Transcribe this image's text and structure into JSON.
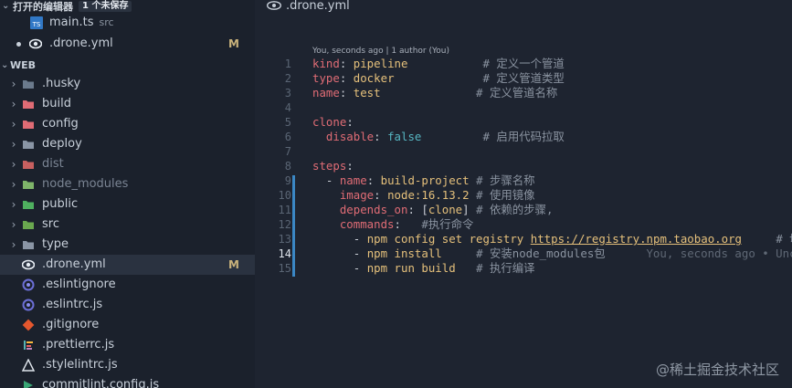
{
  "sidebar": {
    "open_editors": {
      "title": "打开的编辑器",
      "badge": "1 个未保存"
    },
    "open_files": [
      {
        "label": "main.ts",
        "desc": "src",
        "icon": "typescript-icon"
      },
      {
        "label": ".drone.yml",
        "modified": "M",
        "icon": "drone-icon"
      }
    ],
    "section_title": "WEB",
    "tree": [
      {
        "label": ".husky",
        "type": "folder",
        "icon": "husky-folder-icon"
      },
      {
        "label": "build",
        "type": "folder",
        "icon": "build-folder-icon"
      },
      {
        "label": "config",
        "type": "folder",
        "icon": "config-folder-icon"
      },
      {
        "label": "deploy",
        "type": "folder",
        "icon": "folder-icon"
      },
      {
        "label": "dist",
        "type": "folder",
        "icon": "dist-folder-icon"
      },
      {
        "label": "node_modules",
        "type": "folder",
        "icon": "node-modules-folder-icon"
      },
      {
        "label": "public",
        "type": "folder",
        "icon": "public-folder-icon"
      },
      {
        "label": "src",
        "type": "folder",
        "icon": "src-folder-icon"
      },
      {
        "label": "type",
        "type": "folder",
        "icon": "folder-icon"
      },
      {
        "label": ".drone.yml",
        "type": "file",
        "modified": "M",
        "icon": "drone-icon"
      },
      {
        "label": ".eslintignore",
        "type": "file",
        "icon": "eslint-icon"
      },
      {
        "label": ".eslintrc.js",
        "type": "file",
        "icon": "eslint-icon"
      },
      {
        "label": ".gitignore",
        "type": "file",
        "icon": "git-icon"
      },
      {
        "label": ".prettierrc.js",
        "type": "file",
        "icon": "prettier-icon"
      },
      {
        "label": ".stylelintrc.js",
        "type": "file",
        "icon": "stylelint-icon"
      },
      {
        "label": "commitlint.config.js",
        "type": "file",
        "icon": "commitlint-icon"
      }
    ]
  },
  "editor": {
    "tab_label": ".drone.yml",
    "blame_header": "You, seconds ago | 1 author (You)",
    "current_line_blame": "You, seconds ago • Unc",
    "line_numbers": [
      "1",
      "2",
      "3",
      "4",
      "5",
      "6",
      "7",
      "8",
      "9",
      "10",
      "11",
      "12",
      "13",
      "14",
      "15"
    ],
    "code": {
      "l1_key": "kind",
      "l1_val": "pipeline",
      "l1_comment": "# 定义一个管道",
      "l2_key": "type",
      "l2_val": "docker",
      "l2_comment": "# 定义管道类型",
      "l3_key": "name",
      "l3_val": "test",
      "l3_comment": "# 定义管道名称",
      "l5_key": "clone",
      "l6_key": "disable",
      "l6_val": "false",
      "l6_comment": "# 启用代码拉取",
      "l8_key": "steps",
      "l9_key": "name",
      "l9_val": "build-project",
      "l9_comment": "# 步骤名称",
      "l10_key": "image",
      "l10_val": "node:16.13.2",
      "l10_comment": "# 使用镜像",
      "l11_key": "depends_on",
      "l11_val": "clone",
      "l11_comment": "# 依赖的步骤,",
      "l12_key": "commands",
      "l12_comment": "#执行命令",
      "l13_cmd": "npm config set registry ",
      "l13_url": "https://registry.npm.taobao.org",
      "l13_comment": "# 切",
      "l14_cmd": "npm install",
      "l14_comment": "# 安装node_modules包",
      "l15_cmd": "npm run build",
      "l15_comment": "# 执行编译"
    }
  },
  "watermark": "@稀土掘金技术社区",
  "colors": {
    "accent": "#3b87c4",
    "modified": "#c9b27b",
    "keyword": "#e06c75",
    "string": "#e5c07b",
    "boolean": "#56b6c2"
  }
}
